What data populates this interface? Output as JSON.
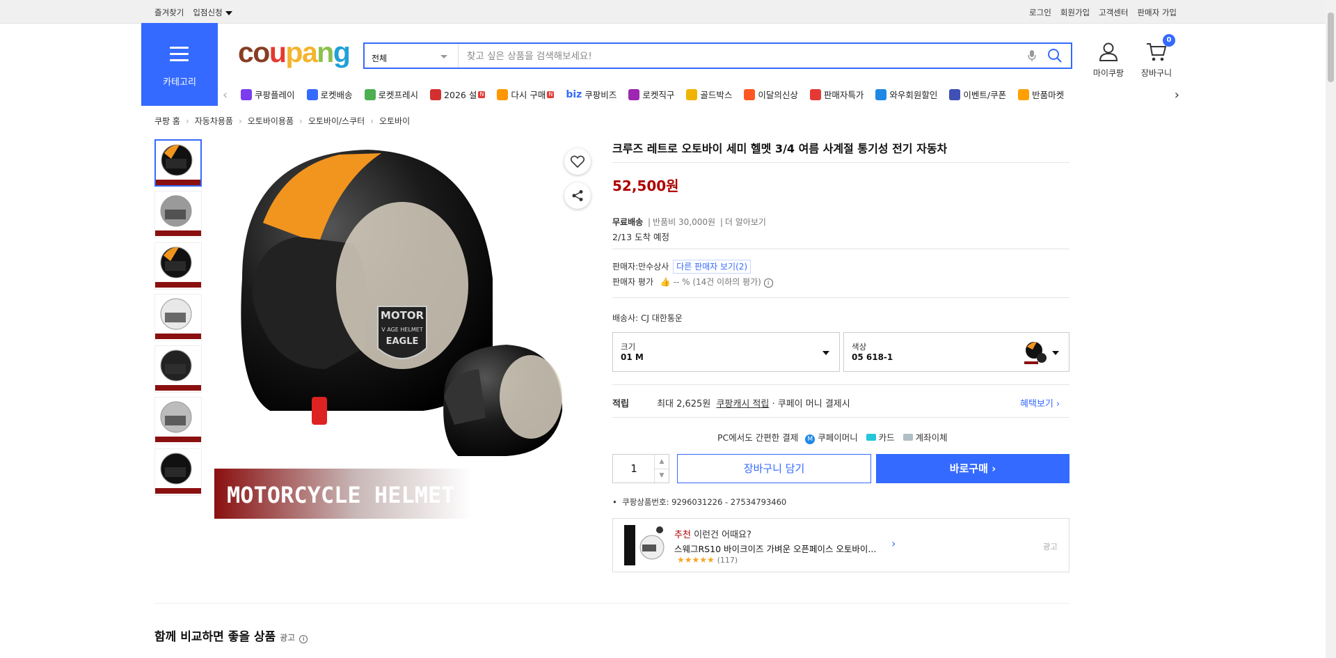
{
  "topbar": {
    "favorites": "즐겨찾기",
    "vendor_apply": "입점신청",
    "login": "로그인",
    "signup": "회원가입",
    "customer_center": "고객센터",
    "seller_signup": "판매자 가입"
  },
  "header": {
    "category_label": "카테고리",
    "logo": {
      "c1": "co",
      "c2": "u",
      "c3": "pa",
      "c4": "n",
      "c5": "g"
    },
    "search_scope": "전체",
    "search_placeholder": "찾고 싶은 상품을 검색해보세요!",
    "mycoupang": "마이쿠팡",
    "cart": "장바구니",
    "cart_count": "0"
  },
  "nav": {
    "items": [
      {
        "label": "쿠팡플레이",
        "color": "#7b3cf0"
      },
      {
        "label": "로켓배송",
        "color": "#346aff"
      },
      {
        "label": "로켓프레시",
        "color": "#4caf50"
      },
      {
        "label": "2026 설",
        "color": "#d32f2f",
        "badge": "N"
      },
      {
        "label": "다시 구매",
        "color": "#ff9800",
        "badge": "N"
      },
      {
        "label": "쿠팡비즈",
        "prefix": "biz",
        "color": "#346aff"
      },
      {
        "label": "로켓직구",
        "color": "#9c27b0"
      },
      {
        "label": "골드박스",
        "color": "#f0b400"
      },
      {
        "label": "이달의신상",
        "color": "#ff5722"
      },
      {
        "label": "판매자특가",
        "color": "#e53935"
      },
      {
        "label": "와우회원할인",
        "color": "#1e88e5"
      },
      {
        "label": "이벤트/쿠폰",
        "color": "#3f51b5"
      },
      {
        "label": "반품마켓",
        "color": "#ffa000"
      }
    ]
  },
  "breadcrumb": [
    "쿠팡 홈",
    "자동차용품",
    "오토바이용품",
    "오토바이/스쿠터",
    "오토바이"
  ],
  "product": {
    "title": "크루즈 레트로 오토바이 세미 헬멧 3/4 여름 사계절 통기성 전기 자동차",
    "price": "52,500원",
    "shipping_free": "무료배송",
    "return_fee": "반품비 30,000원",
    "learn_more": "더 알아보기",
    "arrival": "2/13 도착 예정",
    "seller_label": "판매자:",
    "seller_name": "만수상사",
    "other_sellers": "다른 판매자 보기(2)",
    "seller_rating_label": "판매자 평가",
    "seller_rating_value": "-- % (14건 이하의 평가)",
    "courier_label": "배송사:",
    "courier_name": "CJ 대한통운",
    "option_size_label": "크기",
    "option_size_value": "01 M",
    "option_color_label": "색상",
    "option_color_value": "05 618-1",
    "reward_label": "적립",
    "reward_text1": "최대 2,625원",
    "reward_link": "쿠팡캐시 적립",
    "reward_text2": "· 쿠페이 머니 결제시",
    "benefit_link": "혜택보기",
    "pay_title": "PC에서도 간편한 결제",
    "pay_coupay": "쿠페이머니",
    "pay_card": "카드",
    "pay_bank": "계좌이체",
    "quantity": "1",
    "cart_button": "장바구니 담기",
    "buy_button": "바로구매",
    "product_number": "쿠팡상품번호: 9296031226 - 27534793460",
    "image_banner": "MOTORCYCLE HELMET",
    "helmet_badge_line1": "MOTOR",
    "helmet_badge_line2": "V AGE HELMET",
    "helmet_badge_line3": "EAGLE"
  },
  "recommend": {
    "title_red": "추천",
    "title_rest": "이런건 어때요?",
    "item_name": "스웨그RS10 바이크이즈 가벼운 오픈페이스 오토바이...",
    "stars": "★★★★★",
    "reviews": "(117)",
    "ad": "광고"
  },
  "compare": {
    "title": "함께 비교하면 좋을 상품",
    "ad": "광고"
  }
}
